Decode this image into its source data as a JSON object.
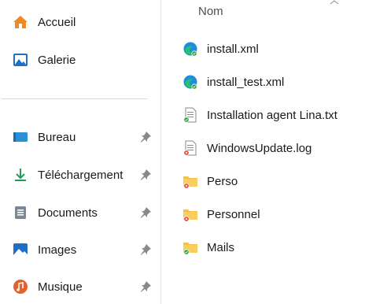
{
  "nav": {
    "items": [
      {
        "label": "Accueil",
        "icon": "home-icon",
        "pinned": false
      },
      {
        "label": "Galerie",
        "icon": "gallery-icon",
        "pinned": false
      },
      {
        "label": "Bureau",
        "icon": "desktop-icon",
        "pinned": true
      },
      {
        "label": "Téléchargement",
        "icon": "download-icon",
        "pinned": true
      },
      {
        "label": "Documents",
        "icon": "documents-icon",
        "pinned": true
      },
      {
        "label": "Images",
        "icon": "images-icon",
        "pinned": true
      },
      {
        "label": "Musique",
        "icon": "music-icon",
        "pinned": true
      }
    ]
  },
  "list": {
    "column_header": "Nom",
    "files": [
      {
        "name": "install.xml",
        "icon": "edge-xml-icon",
        "status": "synced"
      },
      {
        "name": "install_test.xml",
        "icon": "edge-xml-icon",
        "status": "synced"
      },
      {
        "name": "Installation agent Lina.txt",
        "icon": "text-file-icon",
        "status": "synced"
      },
      {
        "name": "WindowsUpdate.log",
        "icon": "text-file-icon",
        "status": "error"
      },
      {
        "name": "Perso",
        "icon": "folder-icon",
        "status": "error"
      },
      {
        "name": "Personnel",
        "icon": "folder-icon",
        "status": "error"
      },
      {
        "name": "Mails",
        "icon": "folder-icon",
        "status": "synced"
      }
    ]
  },
  "colors": {
    "folder": "#f4c04b",
    "synced": "#2e9e3f",
    "error": "#d93025",
    "accent": "#0a6fc2"
  }
}
